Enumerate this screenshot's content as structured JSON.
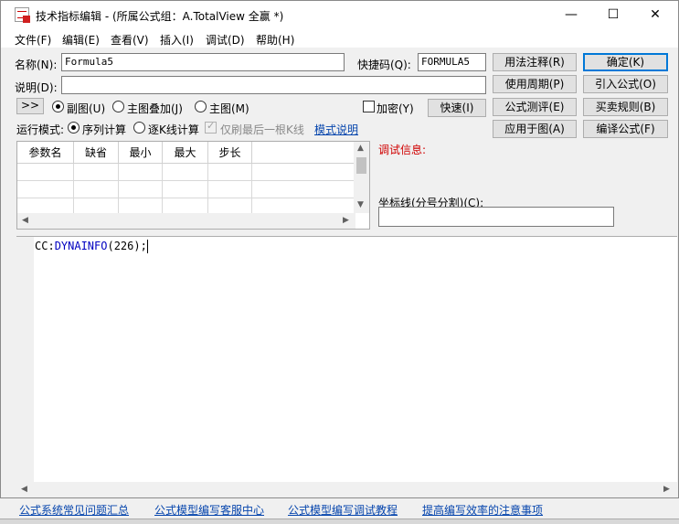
{
  "window": {
    "title": "技术指标编辑 - (所属公式组：A.TotalView 全赢 *)",
    "minimize": "—",
    "maximize": "☐",
    "close": "✕"
  },
  "menu": [
    "文件(F)",
    "编辑(E)",
    "查看(V)",
    "插入(I)",
    "调试(D)",
    "帮助(H)"
  ],
  "form": {
    "name_label": "名称(N):",
    "name_value": "Formula5",
    "shortcut_label": "快捷码(Q):",
    "shortcut_value": "FORMULA5",
    "desc_label": "说明(D):",
    "desc_value": "",
    "expand_button": ">>",
    "radio_sub": "副图(U)",
    "radio_overlay": "主图叠加(J)",
    "radio_main": "主图(M)",
    "encrypt": "加密(Y)",
    "quick_button": "快速(I)",
    "run_mode_label": "运行模式:",
    "run_sequence": "序列计算",
    "run_kline": "逐K线计算",
    "only_last": "仅刷最后一根K线",
    "mode_help": "模式说明"
  },
  "right_buttons": {
    "usage_note": "用法注释(R)",
    "confirm": "确定(K)",
    "period": "使用周期(P)",
    "import_formula": "引入公式(O)",
    "evaluate": "公式测评(E)",
    "trade_rules": "买卖规则(B)",
    "apply_chart": "应用于图(A)",
    "compile": "编译公式(F)"
  },
  "params_table": {
    "headers": [
      "参数名",
      "缺省",
      "最小",
      "最大",
      "步长"
    ],
    "rows": 3
  },
  "debug_label": "调试信息:",
  "axis_label": "坐标线(分号分割)(C):",
  "axis_value": "",
  "code": {
    "prefix": "CC:",
    "func": "DYNAINFO",
    "suffix": "(226);"
  },
  "footer_links": [
    "公式系统常见问题汇总",
    "公式模型编写客服中心",
    "公式模型编写调试教程",
    "提高编写效率的注意事项"
  ]
}
